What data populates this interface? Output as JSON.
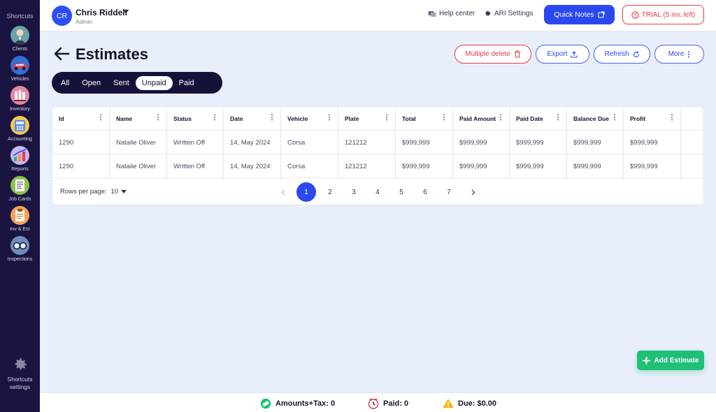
{
  "sidebar": {
    "title": "Shortcuts",
    "items": [
      {
        "label": "Clients",
        "icon": "clients-icon"
      },
      {
        "label": "Vehicles",
        "icon": "vehicles-icon"
      },
      {
        "label": "Inventory",
        "icon": "inventory-icon"
      },
      {
        "label": "Accounting",
        "icon": "accounting-icon"
      },
      {
        "label": "Reports",
        "icon": "reports-icon"
      },
      {
        "label": "Job Cards",
        "icon": "job-cards-icon"
      },
      {
        "label": "Inv & Est",
        "icon": "inv-est-icon"
      },
      {
        "label": "Inspections",
        "icon": "inspections-icon"
      }
    ],
    "settings_label_1": "Shortcuts",
    "settings_label_2": "settings"
  },
  "topbar": {
    "avatar": "CR",
    "user_name": "Chris Riddell",
    "user_role": "Admin",
    "help_center": "Help center",
    "ari_settings": "ARI Settings",
    "quick_notes": "Quick Notes",
    "trial": "TRIAL (5 inv. left)"
  },
  "page": {
    "title": "Estimates",
    "multiple_delete": "Multiple delete",
    "export": "Export",
    "refresh": "Refresh",
    "more": "More"
  },
  "filters": [
    "All",
    "Open",
    "Sent",
    "Unpaid",
    "Paid"
  ],
  "active_filter": "Unpaid",
  "table": {
    "columns": [
      "Id",
      "Name",
      "Status",
      "Date",
      "Vehicle",
      "Plate",
      "Total",
      "Paid Amount",
      "Paid Date",
      "Balance Due",
      "Profit"
    ],
    "rows": [
      [
        "1290",
        "Natalie Oliver",
        "Written Off",
        "14, May 2024",
        "Corsa",
        "121212",
        "$999,999",
        "$999,999",
        "$999,999",
        "$999,999",
        "$999,999"
      ],
      [
        "1290",
        "Natalie Oliver",
        "Written Off",
        "14, May 2024",
        "Corsa",
        "121212",
        "$999,999",
        "$999,999",
        "$999,999",
        "$999,999",
        "$999,999"
      ]
    ],
    "rows_per_page_label": "Rows per page:",
    "rows_per_page_value": "10",
    "pages": [
      "1",
      "2",
      "3",
      "4",
      "5",
      "6",
      "7"
    ],
    "current_page": "1"
  },
  "add_estimate": "Add Estimate",
  "footer": {
    "amounts": "Amounts+Tax: 0",
    "paid": "Paid: 0",
    "due": "Due: $0.00"
  },
  "colors": {
    "primary": "#2b48ef",
    "danger": "#e63946",
    "success": "#1fbf76",
    "sidebar": "#1a1440"
  }
}
